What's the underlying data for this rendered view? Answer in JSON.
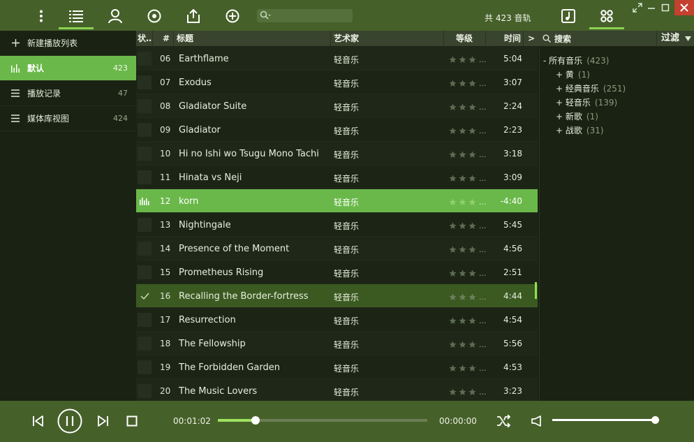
{
  "app": {
    "track_total": "共 423 音轨",
    "search_placeholder": ""
  },
  "sidebar": {
    "items": [
      {
        "label": "新建播放列表",
        "count": "",
        "icon": "plus-icon"
      },
      {
        "label": "默认",
        "count": "423",
        "icon": "equalizer-bars-icon",
        "active": true
      },
      {
        "label": "播放记录",
        "count": "47",
        "icon": "list-lines-icon"
      },
      {
        "label": "媒体库视图",
        "count": "424",
        "icon": "list-lines-icon"
      }
    ]
  },
  "tracklist": {
    "columns": {
      "status": "状…",
      "number": "#",
      "title": "标题",
      "artist": "艺术家",
      "rating": "等级",
      "time": "时间",
      "more": ">"
    },
    "rating_more": "...",
    "rows": [
      {
        "num": "06",
        "title": "Earthflame",
        "artist": "轻音乐",
        "time": "5:04",
        "state": ""
      },
      {
        "num": "07",
        "title": "Exodus",
        "artist": "轻音乐",
        "time": "3:07",
        "state": ""
      },
      {
        "num": "08",
        "title": "Gladiator Suite",
        "artist": "轻音乐",
        "time": "2:24",
        "state": ""
      },
      {
        "num": "09",
        "title": "Gladiator",
        "artist": "轻音乐",
        "time": "2:23",
        "state": ""
      },
      {
        "num": "10",
        "title": "Hi no Ishi wo Tsugu Mono Tachi",
        "artist": "轻音乐",
        "time": "3:18",
        "state": ""
      },
      {
        "num": "11",
        "title": "Hinata vs Neji",
        "artist": "轻音乐",
        "time": "3:09",
        "state": ""
      },
      {
        "num": "12",
        "title": "korn",
        "artist": "轻音乐",
        "time": "-4:40",
        "state": "playing"
      },
      {
        "num": "13",
        "title": "Nightingale",
        "artist": "轻音乐",
        "time": "5:45",
        "state": ""
      },
      {
        "num": "14",
        "title": "Presence of the Moment",
        "artist": "轻音乐",
        "time": "4:56",
        "state": ""
      },
      {
        "num": "15",
        "title": "Prometheus Rising",
        "artist": "轻音乐",
        "time": "2:51",
        "state": ""
      },
      {
        "num": "16",
        "title": "Recalling the Border-fortress",
        "artist": "轻音乐",
        "time": "4:44",
        "state": "selected"
      },
      {
        "num": "17",
        "title": "Resurrection",
        "artist": "轻音乐",
        "time": "4:54",
        "state": ""
      },
      {
        "num": "18",
        "title": "The Fellowship",
        "artist": "轻音乐",
        "time": "5:56",
        "state": ""
      },
      {
        "num": "19",
        "title": "The Forbidden Garden",
        "artist": "轻音乐",
        "time": "4:53",
        "state": ""
      },
      {
        "num": "20",
        "title": "The Music Lovers",
        "artist": "轻音乐",
        "time": "3:23",
        "state": ""
      }
    ]
  },
  "filter": {
    "search_label": "搜索",
    "filter_label": "过滤",
    "tree": [
      {
        "prefix": "-",
        "label": "所有音乐",
        "count": "(423)",
        "level": 0
      },
      {
        "prefix": "+",
        "label": "黄",
        "count": "(1)",
        "level": 1
      },
      {
        "prefix": "+",
        "label": "经典音乐",
        "count": "(251)",
        "level": 1
      },
      {
        "prefix": "+",
        "label": "轻音乐",
        "count": "(139)",
        "level": 1
      },
      {
        "prefix": "+",
        "label": "新歌",
        "count": "(1)",
        "level": 1
      },
      {
        "prefix": "+",
        "label": "战歌",
        "count": "(31)",
        "level": 1
      }
    ]
  },
  "player": {
    "time_current": "00:01:02",
    "time_total": "00:00:00",
    "progress_fraction": 0.18,
    "volume_fraction": 1.0
  },
  "colors": {
    "accent": "#6ab84a",
    "topbar": "#46602a",
    "close": "#c4402f"
  }
}
